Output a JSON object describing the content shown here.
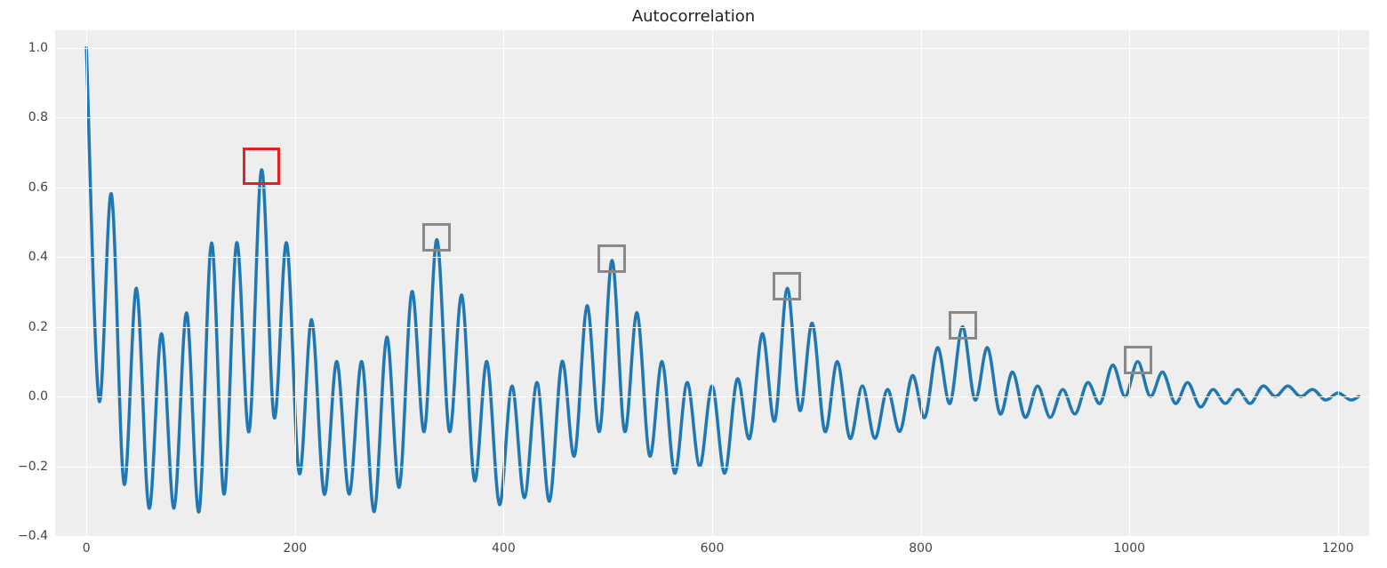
{
  "chart_data": {
    "type": "line",
    "title": "Autocorrelation",
    "xlabel": "",
    "ylabel": "",
    "xlim": [
      -30,
      1230
    ],
    "ylim": [
      -0.4,
      1.05
    ],
    "x_ticks": [
      0,
      200,
      400,
      600,
      800,
      1000,
      1200
    ],
    "y_ticks": [
      -0.4,
      -0.2,
      0.0,
      0.2,
      0.4,
      0.6,
      0.8,
      1.0
    ],
    "grid": true,
    "series": [
      {
        "name": "autocorrelation",
        "color": "#1f77b4",
        "x": [
          0,
          12,
          24,
          36,
          48,
          60,
          72,
          84,
          96,
          108,
          120,
          132,
          144,
          156,
          168,
          180,
          192,
          204,
          216,
          228,
          240,
          252,
          264,
          276,
          288,
          300,
          312,
          324,
          336,
          348,
          360,
          372,
          384,
          396,
          408,
          420,
          432,
          444,
          456,
          468,
          480,
          492,
          504,
          516,
          528,
          540,
          552,
          564,
          576,
          588,
          600,
          612,
          624,
          636,
          648,
          660,
          672,
          684,
          696,
          708,
          720,
          732,
          744,
          756,
          768,
          780,
          792,
          804,
          816,
          828,
          840,
          852,
          864,
          876,
          888,
          900,
          912,
          924,
          936,
          948,
          960,
          972,
          984,
          996,
          1008,
          1020,
          1032,
          1044,
          1056,
          1068,
          1080,
          1092,
          1104,
          1116,
          1128,
          1140,
          1152,
          1164,
          1176,
          1188,
          1200,
          1212,
          1220
        ],
        "y": [
          1.0,
          -0.01,
          0.58,
          -0.25,
          0.31,
          -0.32,
          0.18,
          -0.32,
          0.24,
          -0.33,
          0.44,
          -0.28,
          0.44,
          -0.1,
          0.65,
          -0.06,
          0.44,
          -0.22,
          0.22,
          -0.28,
          0.1,
          -0.28,
          0.1,
          -0.33,
          0.17,
          -0.26,
          0.3,
          -0.1,
          0.45,
          -0.1,
          0.29,
          -0.24,
          0.1,
          -0.31,
          0.03,
          -0.29,
          0.04,
          -0.3,
          0.1,
          -0.17,
          0.26,
          -0.1,
          0.39,
          -0.1,
          0.24,
          -0.17,
          0.1,
          -0.22,
          0.04,
          -0.2,
          0.03,
          -0.22,
          0.05,
          -0.12,
          0.18,
          -0.07,
          0.31,
          -0.04,
          0.21,
          -0.1,
          0.1,
          -0.12,
          0.03,
          -0.12,
          0.02,
          -0.1,
          0.06,
          -0.06,
          0.14,
          -0.02,
          0.2,
          -0.01,
          0.14,
          -0.05,
          0.07,
          -0.06,
          0.03,
          -0.06,
          0.02,
          -0.05,
          0.04,
          -0.02,
          0.09,
          0.0,
          0.1,
          0.0,
          0.07,
          -0.02,
          0.04,
          -0.03,
          0.02,
          -0.02,
          0.02,
          -0.02,
          0.03,
          0.0,
          0.03,
          0.0,
          0.02,
          -0.01,
          0.01,
          -0.01,
          0.0
        ]
      }
    ],
    "annotations": {
      "peak_boxes": [
        {
          "x": 168,
          "y": 0.65,
          "primary": true
        },
        {
          "x": 336,
          "y": 0.45,
          "primary": false
        },
        {
          "x": 504,
          "y": 0.39,
          "primary": false
        },
        {
          "x": 672,
          "y": 0.31,
          "primary": false
        },
        {
          "x": 840,
          "y": 0.2,
          "primary": false
        },
        {
          "x": 1008,
          "y": 0.1,
          "primary": false
        }
      ]
    }
  }
}
